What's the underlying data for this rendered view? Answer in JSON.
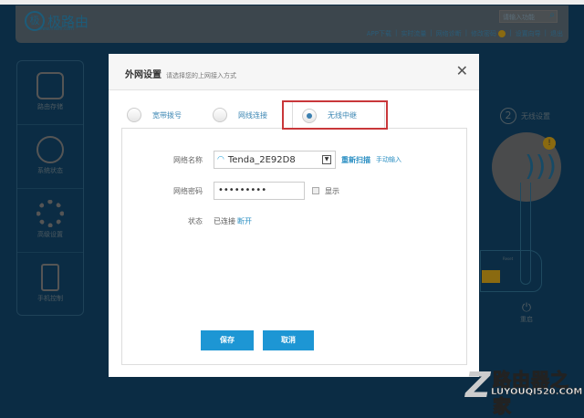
{
  "header": {
    "logo_text": "极路由",
    "logo_url": "www.hiwifi.com",
    "search_placeholder": "请输入功能",
    "nav": [
      "APP下载",
      "实时流量",
      "网络诊断",
      "修改密码",
      "设置向导",
      "退出"
    ]
  },
  "sidebar": {
    "items": [
      {
        "label": "路由存储",
        "icon": "database-icon"
      },
      {
        "label": "系统状态",
        "icon": "pulse-icon"
      },
      {
        "label": "高级设置",
        "icon": "gear-icon"
      },
      {
        "label": "手机控制",
        "icon": "phone-icon"
      }
    ]
  },
  "right": {
    "step_number": "2",
    "step_label": "无线设置",
    "warning": "!",
    "reset_label": "重启",
    "device_label": "Reset"
  },
  "modal": {
    "title": "外网设置",
    "subtitle": "请选择您的上网接入方式",
    "close": "✕",
    "tabs": [
      {
        "label": "宽带拨号",
        "selected": false
      },
      {
        "label": "网线连接",
        "selected": false
      },
      {
        "label": "无线中继",
        "selected": true
      }
    ],
    "network_name_label": "网络名称",
    "network_name_value": "Tenda_2E92D8",
    "rescan": "重新扫描",
    "manual": "手动输入",
    "password_label": "网络密码",
    "password_value": "•••••••••",
    "show_label": "显示",
    "status_label": "状态",
    "status_value": "已连接",
    "disconnect": "断开",
    "save": "保存",
    "cancel": "取消"
  },
  "watermark": {
    "cn": "路由器之家",
    "url": "LUYOUQI520.COM"
  }
}
